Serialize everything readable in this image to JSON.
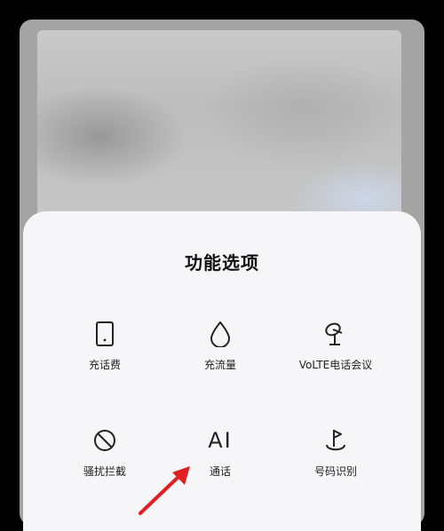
{
  "sheet": {
    "title": "功能选项",
    "options": [
      {
        "label": "充话费",
        "icon": "phone-icon"
      },
      {
        "label": "充流量",
        "icon": "droplet-icon"
      },
      {
        "label": "VoLTE电话会议",
        "icon": "antenna-icon"
      },
      {
        "label": "骚扰拦截",
        "icon": "block-icon"
      },
      {
        "label": "通话",
        "icon": "ai-icon",
        "glyph": "AI"
      },
      {
        "label": "号码识别",
        "icon": "flag-icon"
      }
    ]
  },
  "colors": {
    "background": "#000000",
    "sheet": "#f6f6f8",
    "annotation_arrow": "#e02020"
  }
}
